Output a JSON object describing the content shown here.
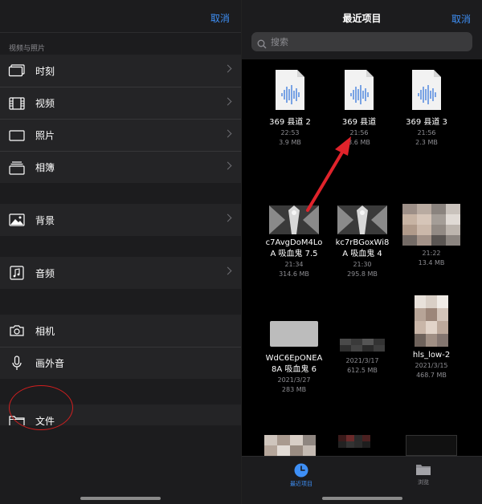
{
  "left": {
    "cancel": "取消",
    "section_title": "视频与照片",
    "items": [
      {
        "label": "时刻",
        "icon": "moments-icon"
      },
      {
        "label": "视频",
        "icon": "film-icon"
      },
      {
        "label": "照片",
        "icon": "photo-icon"
      },
      {
        "label": "相簿",
        "icon": "album-icon"
      },
      {
        "label": "背景",
        "icon": "landscape-icon"
      },
      {
        "label": "音频",
        "icon": "music-note-icon"
      },
      {
        "label": "相机",
        "icon": "camera-icon"
      },
      {
        "label": "画外音",
        "icon": "microphone-icon"
      },
      {
        "label": "文件",
        "icon": "folder-icon"
      }
    ]
  },
  "right": {
    "title": "最近项目",
    "cancel": "取消",
    "search_placeholder": "搜索",
    "files": [
      {
        "name": "369 县道 2",
        "line2": "",
        "time": "22:53",
        "size": "3.9 MB"
      },
      {
        "name": "369 县道",
        "line2": "",
        "time": "21:56",
        "size": "3.6 MB"
      },
      {
        "name": "369 县道 3",
        "line2": "",
        "time": "21:56",
        "size": "2.3 MB"
      },
      {
        "name": "c7AvgDoM4Lo",
        "line2": "A 吸血鬼 7.5",
        "time": "21:34",
        "size": "314.6 MB"
      },
      {
        "name": "kc7rBGoxWi8",
        "line2": "A 吸血鬼 4",
        "time": "21:30",
        "size": "295.8 MB"
      },
      {
        "name": "",
        "line2": "",
        "time": "21:22",
        "size": "13.4 MB"
      },
      {
        "name": "WdC6EpONEA",
        "line2": "8A 吸血鬼 6",
        "time": "2021/3/27",
        "size": "283 MB"
      },
      {
        "name": "",
        "line2": "",
        "time": "2021/3/17",
        "size": "612.5 MB"
      },
      {
        "name": "hls_low-2",
        "line2": "",
        "time": "2021/3/15",
        "size": "468.7 MB"
      }
    ],
    "tabs": [
      {
        "label": "最近项目",
        "icon": "clock-icon",
        "active": true
      },
      {
        "label": "浏览",
        "icon": "folder-icon",
        "active": false
      }
    ]
  },
  "colors": {
    "accent": "#3e8ff6",
    "annotation": "#e0232b"
  }
}
